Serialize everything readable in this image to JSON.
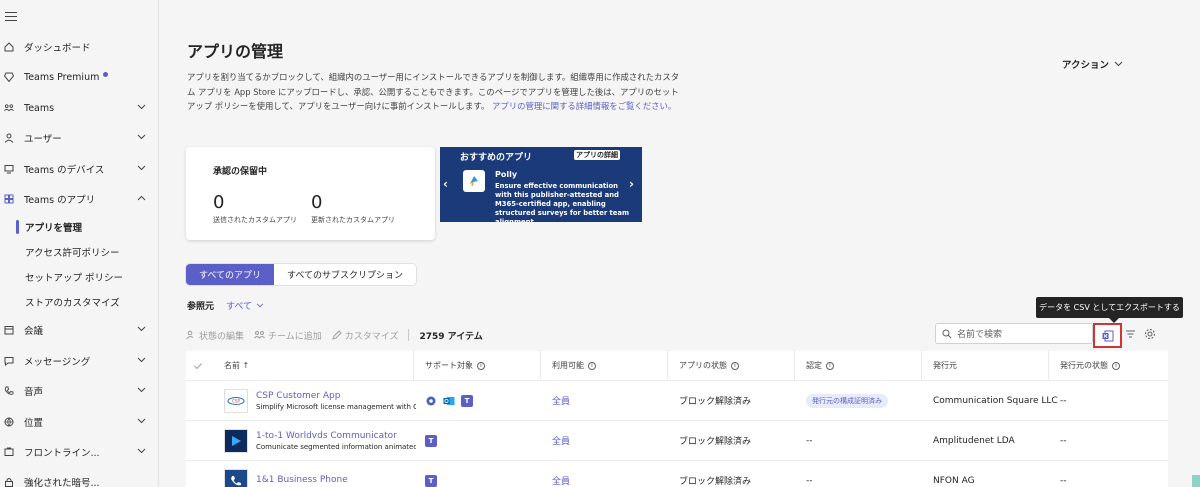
{
  "sidebar": {
    "items": [
      {
        "label": "ダッシュボード",
        "icon": "home-icon",
        "chevron": false
      },
      {
        "label": "Teams Premium",
        "icon": "diamond-icon",
        "chevron": false,
        "dot": true
      },
      {
        "label": "Teams",
        "icon": "teams-people-icon",
        "chevron": true
      },
      {
        "label": "ユーザー",
        "icon": "user-icon",
        "chevron": true
      },
      {
        "label": "Teams のデバイス",
        "icon": "device-icon",
        "chevron": true
      },
      {
        "label": "Teams のアプリ",
        "icon": "apps-icon",
        "chevron": true,
        "expanded": true
      },
      {
        "label": "会議",
        "icon": "calendar-icon",
        "chevron": true
      },
      {
        "label": "メッセージング",
        "icon": "chat-icon",
        "chevron": true
      },
      {
        "label": "音声",
        "icon": "phone-icon",
        "chevron": true
      },
      {
        "label": "位置",
        "icon": "globe-icon",
        "chevron": true
      },
      {
        "label": "フロントライン...",
        "icon": "frontline-icon",
        "chevron": true
      },
      {
        "label": "強化された暗号...",
        "icon": "lock-icon",
        "chevron": false
      }
    ],
    "subitems": [
      {
        "label": "アプリを管理",
        "active": true
      },
      {
        "label": "アクセス許可ポリシー",
        "active": false
      },
      {
        "label": "セットアップ ポリシー",
        "active": false
      },
      {
        "label": "ストアのカスタマイズ",
        "active": false
      }
    ]
  },
  "page": {
    "title": "アプリの管理",
    "desc_1": "アプリを割り当てるかブロックして、組織内のユーザー用にインストールできるアプリを制御します。組織専用に作成されたカスタム アプリを App Store にアップロードし、承認、公開することもできます。このページでアプリを管理した後は、アプリのセットアップ ポリシーを使用して、アプリをユーザー向けに事前インストールします。",
    "desc_link": "アプリの管理に関する詳細情報をご覧ください。",
    "action": "アクション"
  },
  "pending": {
    "title": "承認の保留中",
    "submitted_count": "0",
    "submitted_label": "送信されたカスタムアプリ",
    "updated_count": "0",
    "updated_label": "更新されたカスタムアプリ"
  },
  "promo": {
    "header": "おすすめのアプリ",
    "detail": "アプリの詳細",
    "app_name": "Polly",
    "app_desc": "Ensure effective communication with this publisher-attested and M365-certified app, enabling structured surveys for better team alignment."
  },
  "tabs": [
    "すべてのアプリ",
    "すべてのサブスクリプション"
  ],
  "filter": {
    "label": "参照元",
    "value": "すべて"
  },
  "toolbar": {
    "edit_status": "状態の編集",
    "add_to_team": "チームに追加",
    "customize": "カスタマイズ",
    "item_count": "2759 アイテム",
    "search_placeholder": "名前で検索",
    "csv_tooltip": "データを CSV としてエクスポートする"
  },
  "table": {
    "headers": {
      "name": "名前",
      "sort": "↑",
      "supported": "サポート対象",
      "available": "利用可能",
      "app_status": "アプリの状態",
      "certification": "認定",
      "publisher": "発行元",
      "publisher_status": "発行元の状態"
    },
    "rows": [
      {
        "name": "CSP Customer App",
        "desc": "Simplify Microsoft license management with CSP",
        "available": "全員",
        "status": "ブロック解除済み",
        "certification": "発行元の構成証明済み",
        "publisher": "Communication Square LLC",
        "publisher_status": "--"
      },
      {
        "name": "1-to-1 Worldvds Communicator",
        "desc": "Comunicate segmented information animated",
        "available": "全員",
        "status": "ブロック解除済み",
        "certification": "--",
        "publisher": "Amplitudenet LDA",
        "publisher_status": "--"
      },
      {
        "name": "1&1 Business Phone",
        "desc": "",
        "available": "全員",
        "status": "ブロック解除済み",
        "certification": "--",
        "publisher": "NFON AG",
        "publisher_status": "--"
      }
    ]
  },
  "colors": {
    "accent": "#5b5fc7",
    "highlight": "#d13438",
    "promo_bg": "#1a3a7a"
  }
}
